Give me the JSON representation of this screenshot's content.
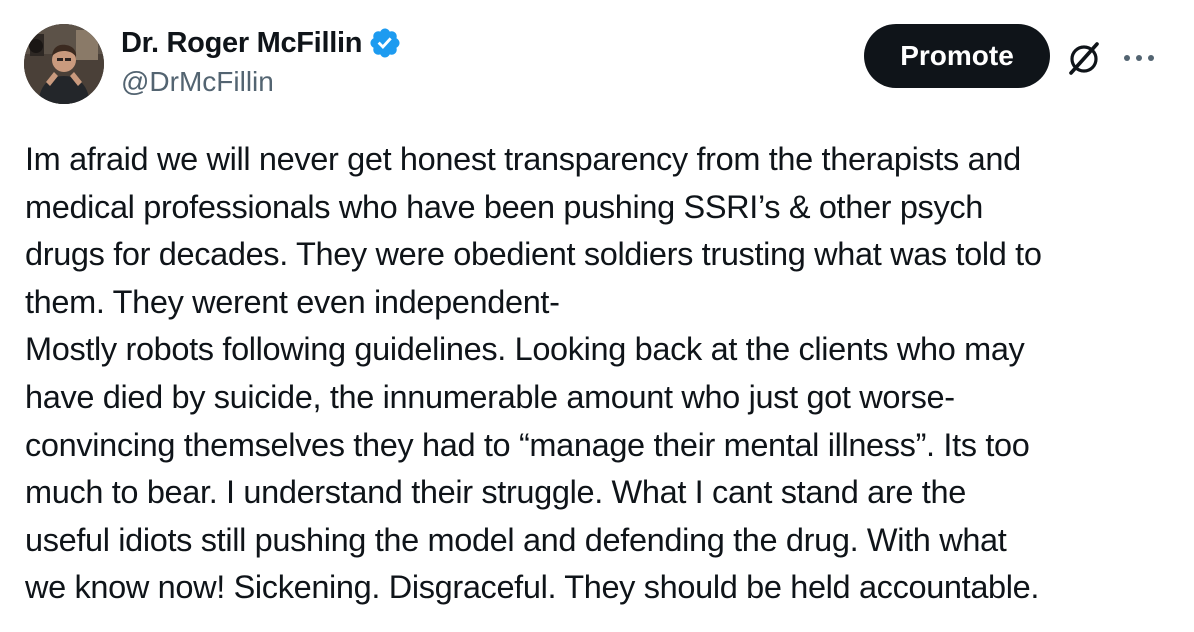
{
  "author": {
    "display_name": "Dr. Roger McFillin",
    "handle": "@DrMcFillin",
    "verified": true,
    "verified_color": "#1d9bf0",
    "avatar_icon": "profile-photo"
  },
  "actions": {
    "promote_label": "Promote",
    "grok_icon": "grok-icon",
    "more_icon": "more-icon"
  },
  "tweet": {
    "lines": [
      "Im afraid we will never get honest transparency from the therapists and",
      "medical professionals who have been pushing SSRI’s & other psych",
      "drugs for decades. They were obedient soldiers trusting what was told to",
      "them. They werent even independent-",
      "Mostly robots following guidelines. Looking back at the clients who may",
      "have died by suicide, the innumerable amount who just got worse-",
      "convincing themselves they had to “manage their mental illness”. Its too",
      "much to bear. I understand their struggle. What I cant stand are the",
      "useful idiots still pushing the model and defending the drug. With what",
      "we know now! Sickening. Disgraceful. They should be held accountable."
    ]
  }
}
